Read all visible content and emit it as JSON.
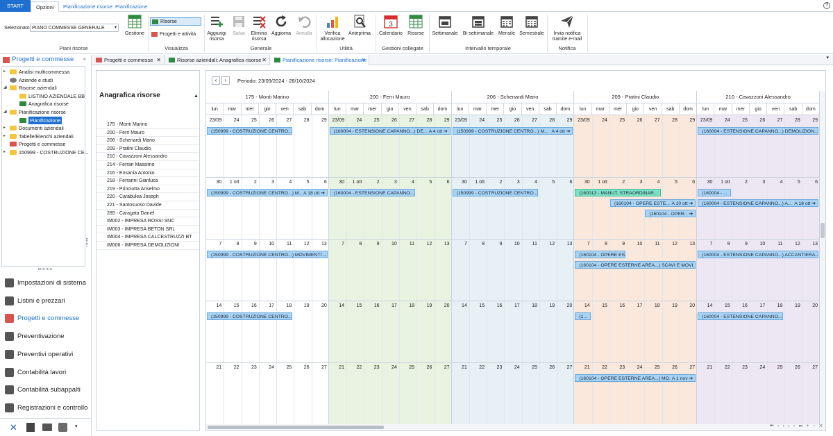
{
  "tabs": {
    "start": "START",
    "opzioni": "Opzioni",
    "context": "Pianificazione risorse: Pianificazione"
  },
  "ribbon": {
    "selezionato_label": "Selezionato",
    "selezionato_value": "PIANO COMMESSE GENERALE",
    "gestione": "Gestione",
    "risorse_toggle": "Risorse",
    "progetti_attivita": "Progetti e attività",
    "aggiungi": "Aggiungi risorsa",
    "salva": "Salva",
    "elimina": "Elimina risorsa",
    "aggiorna": "Aggiorna",
    "annulla": "Annulla",
    "verifica": "Verifica allocazione",
    "anteprima": "Anteprima",
    "calendario": "Calendario",
    "risorse": "Risorse",
    "settimanale": "Settimanale",
    "bisettimanale": "Bi-settimanale",
    "mensile": "Mensile",
    "semestrale": "Semestrale",
    "invia": "Invia notifica tramite e-mail",
    "calendar_icon_number": "3",
    "groups": {
      "piani": "Piani risorse",
      "visualizza": "Visualizza",
      "generale": "Generale",
      "utilita": "Utilità",
      "gestioni": "Gestioni collegate",
      "intervallo": "Intervallo temporale",
      "notifica": "Notifica"
    }
  },
  "left": {
    "title": "Progetti e commesse",
    "tree": [
      {
        "label": "Analisi multicommessa",
        "level": 0,
        "icon": "folder",
        "arrow": true
      },
      {
        "label": "Aziende e studi",
        "level": 0,
        "icon": "people",
        "arrow": false
      },
      {
        "label": "Risorse aziendali",
        "level": 0,
        "icon": "folder",
        "arrow": true,
        "open": true
      },
      {
        "label": "LISTINO AZIENDALE BB",
        "level": 1,
        "icon": "folder",
        "arrow": false
      },
      {
        "label": "Anagrafica risorse",
        "level": 1,
        "icon": "grid",
        "arrow": false
      },
      {
        "label": "Pianificazione risorse",
        "level": 0,
        "icon": "folder",
        "arrow": true,
        "open": true
      },
      {
        "label": "Pianificazione",
        "level": 1,
        "icon": "grid",
        "arrow": false,
        "selected": true
      },
      {
        "label": "Documenti aziendali",
        "level": 0,
        "icon": "folder",
        "arrow": true
      },
      {
        "label": "Tabelle/Elenchi aziendali",
        "level": 0,
        "icon": "folder",
        "arrow": true
      },
      {
        "label": "Progetti e commesse",
        "level": 0,
        "icon": "red",
        "arrow": false
      },
      {
        "label": "150999 - COSTRUZIONE CE...",
        "level": 0,
        "icon": "folder",
        "arrow": true
      }
    ],
    "nav": [
      {
        "label": "Impostazioni di sistema",
        "icon": "gear-icon"
      },
      {
        "label": "Listini e prezzari",
        "icon": "books-icon"
      },
      {
        "label": "Progetti e commesse",
        "icon": "projects-icon",
        "active": true
      },
      {
        "label": "Preventivazione",
        "icon": "chart-icon"
      },
      {
        "label": "Preventivi operativi",
        "icon": "arrows-icon"
      },
      {
        "label": "Contabilità lavori",
        "icon": "ledger-icon"
      },
      {
        "label": "Contabilità subappalti",
        "icon": "truck-icon"
      },
      {
        "label": "Registrazioni e controllo",
        "icon": "settings-icon"
      }
    ]
  },
  "doctabs": [
    {
      "label": "Progetti e commesse"
    },
    {
      "label": "Risorse aziendali: Anagrafica risorse"
    },
    {
      "label": "Pianificazione risorse: Pianificazione",
      "active": true
    }
  ],
  "resources": {
    "title": "Anagrafica risorse",
    "rows": [
      "175 - Monti Marino",
      "200 - Ferri Mauro",
      "206 - Schenardi Mario",
      "209 - Pratini Claudio",
      "210 - Cavazzoni Alessandro",
      "214 - Ferrari Massimo",
      "216 - Ensania Antonio",
      "218 - Ferrarini Gianluca",
      "219 - Princiotta Anselmo",
      "220 - Carabulea Joseph",
      "221 - Santosuoso Davide",
      "285 - Caragata Daniel",
      "IM002 - IMPRESA ROSSI SNC",
      "IM003 - IMPRESA BETON SRL",
      "IM004 - IMPRESA CALCESTRUZZI BT",
      "IM006 - IMPRESA DEMOLIZIONI"
    ]
  },
  "calendar": {
    "period": "Periodo: 23/09/2024 - 28/10/2024",
    "day_names": [
      "lun",
      "mar",
      "mer",
      "gio",
      "ven",
      "sab",
      "dom"
    ],
    "resources": [
      {
        "name": "175 - Monti Marino",
        "bg": "#ffffff"
      },
      {
        "name": "200 - Ferri Mauro",
        "bg": "#e9f3e1"
      },
      {
        "name": "206 - Schenardi Mario",
        "bg": "#e6f0f5"
      },
      {
        "name": "209 - Pratini Claudio",
        "bg": "#fbe8dc"
      },
      {
        "name": "210 - Cavazzoni Alessandro",
        "bg": "#ede7f4"
      }
    ],
    "weeks": [
      [
        "23/09",
        "24",
        "25",
        "26",
        "27",
        "28",
        "29"
      ],
      [
        "30",
        "1 ott",
        "2",
        "3",
        "4",
        "5",
        "6"
      ],
      [
        "7",
        "8",
        "9",
        "10",
        "11",
        "12",
        "13"
      ],
      [
        "14",
        "15",
        "16",
        "17",
        "18",
        "19",
        "20"
      ],
      [
        "21",
        "22",
        "23",
        "24",
        "25",
        "26",
        "27"
      ]
    ],
    "events": [
      {
        "res": 0,
        "week": 0,
        "start": 0,
        "span": 5,
        "lane": 0,
        "text": "(150999 - COSTRUZIONE CENTRO...",
        "tail": ""
      },
      {
        "res": 1,
        "week": 0,
        "start": 0,
        "span": 7,
        "lane": 0,
        "text": "(160004 - ESTENSIONE CAPANNO...) DE...",
        "tail": "A 4 ott ➔"
      },
      {
        "res": 2,
        "week": 0,
        "start": 0,
        "span": 7,
        "lane": 0,
        "text": "(150999 - COSTRUZIONE CENTRO...) M...",
        "tail": "A 4 ott ➔"
      },
      {
        "res": 4,
        "week": 0,
        "start": 0,
        "span": 7,
        "lane": 0,
        "text": "(160004 - ESTENSIONE CAPANNO...) DEMOLIZION...",
        "tail": ""
      },
      {
        "res": 0,
        "week": 1,
        "start": 0,
        "span": 7,
        "lane": 0,
        "text": "(150999 - COSTRUZIONE CENTRO...) M...",
        "tail": "A 18 ott ➔"
      },
      {
        "res": 1,
        "week": 1,
        "start": 0,
        "span": 5,
        "lane": 0,
        "text": "(160004 - ESTENSIONE CAPANNO...",
        "tail": ""
      },
      {
        "res": 2,
        "week": 1,
        "start": 0,
        "span": 5,
        "lane": 0,
        "text": "(150999 - COSTRUZIONE CENTRO...",
        "tail": ""
      },
      {
        "res": 3,
        "week": 1,
        "start": 0,
        "span": 5,
        "lane": 0,
        "text": "(160013 - MANUT. STRAORDINAR...",
        "tail": "",
        "green": true
      },
      {
        "res": 4,
        "week": 1,
        "start": 0,
        "span": 2,
        "lane": 0,
        "text": "(160004 - ...",
        "tail": ""
      },
      {
        "res": 3,
        "week": 1,
        "start": 2,
        "span": 5,
        "lane": 1,
        "text": "(160104 - OPERE ESTE...",
        "tail": "A 10 ott ➔"
      },
      {
        "res": 4,
        "week": 1,
        "start": 0,
        "span": 7,
        "lane": 1,
        "text": "(160004 - ESTENSIONE CAPANNO...) A...",
        "tail": "A 18 ott ➔"
      },
      {
        "res": 3,
        "week": 1,
        "start": 4,
        "span": 3,
        "lane": 2,
        "text": "(160104 - OPER...",
        "tail": "➔"
      },
      {
        "res": 0,
        "week": 2,
        "start": 0,
        "span": 7,
        "lane": 0,
        "text": "(150999 - COSTRUZIONE CENTRO...) MOVIMENTI ...",
        "tail": ""
      },
      {
        "res": 3,
        "week": 2,
        "start": 0,
        "span": 3,
        "lane": 0,
        "text": "(160104 - OPERE ESTERNE ...",
        "tail": ""
      },
      {
        "res": 4,
        "week": 2,
        "start": 0,
        "span": 7,
        "lane": 0,
        "text": "(160004 - ESTENSIONE CAPANNO...) ACCANTIERA...",
        "tail": ""
      },
      {
        "res": 3,
        "week": 2,
        "start": 0,
        "span": 7,
        "lane": 1,
        "text": "(160104 - OPERE ESTERNE AREA...) SCAVI E MOVI...",
        "tail": ""
      },
      {
        "res": 0,
        "week": 3,
        "start": 0,
        "span": 5,
        "lane": 0,
        "text": "(150999 - COSTRUZIONE CENTRO...",
        "tail": ""
      },
      {
        "res": 3,
        "week": 3,
        "start": 0,
        "span": 1,
        "lane": 0,
        "text": "(1...",
        "tail": ""
      },
      {
        "res": 4,
        "week": 3,
        "start": 0,
        "span": 5,
        "lane": 0,
        "text": "(160004 - ESTENSIONE CAPANNO...",
        "tail": ""
      },
      {
        "res": 3,
        "week": 4,
        "start": 0,
        "span": 7,
        "lane": 0,
        "text": "(160104 - OPERE ESTERNE AREA...) MO...",
        "tail": "A 1 nov ➔"
      }
    ]
  }
}
